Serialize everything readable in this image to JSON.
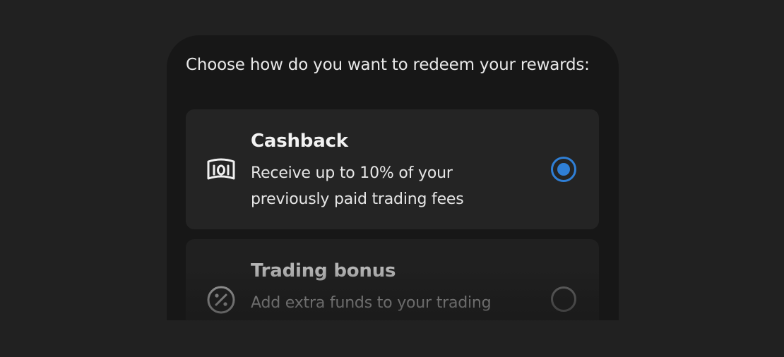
{
  "prompt": "Choose how do you want to redeem your rewards:",
  "options": [
    {
      "icon": "banknote-icon",
      "title": "Cashback",
      "description": "Receive up to 10% of your previously paid trading fees",
      "selected": true
    },
    {
      "icon": "percent-icon",
      "title": "Trading bonus",
      "description": "Add extra funds to your trading account balance",
      "selected": false
    }
  ],
  "colors": {
    "background": "#212121",
    "sheet": "#171717",
    "card": "#242424",
    "accent": "#2f7fd6",
    "text": "#f2f2f2"
  }
}
